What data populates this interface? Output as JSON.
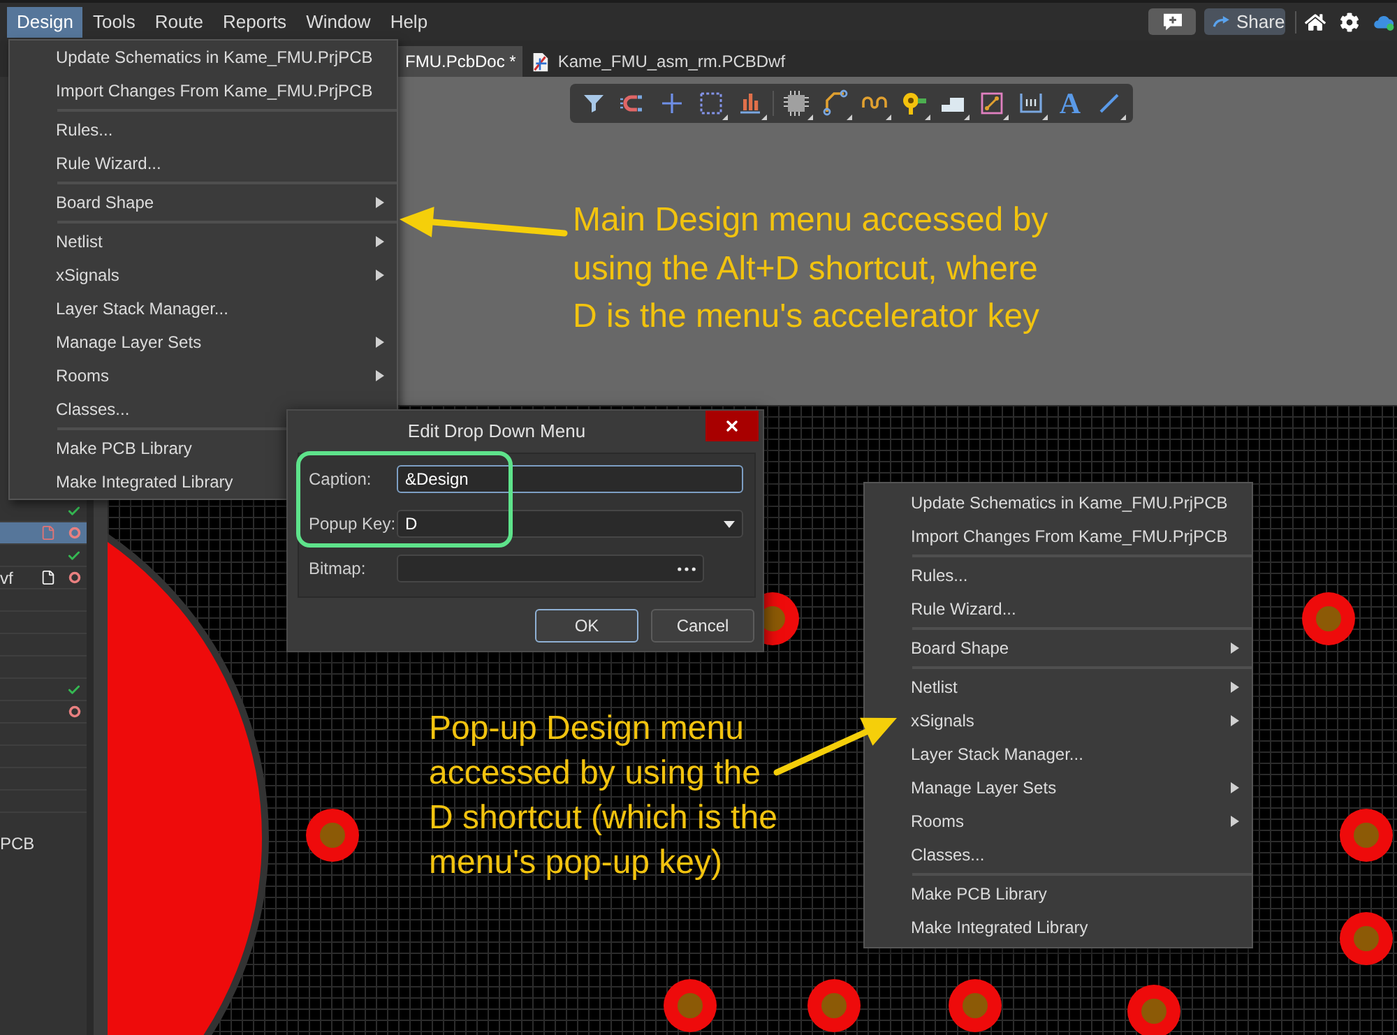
{
  "menu_bar": {
    "items": [
      {
        "label": "Design",
        "selected": true
      },
      {
        "label": "Tools",
        "selected": false
      },
      {
        "label": "Route",
        "selected": false
      },
      {
        "label": "Reports",
        "selected": false
      },
      {
        "label": "Window",
        "selected": false
      },
      {
        "label": "Help",
        "selected": false
      }
    ],
    "share_button": "Share"
  },
  "document_tabs": [
    {
      "label": "FMU.PcbDoc *",
      "selected": true
    },
    {
      "label": "Kame_FMU_asm_rm.PCBDwf",
      "selected": false,
      "kind": "drawing"
    }
  ],
  "design_menu": {
    "groups": [
      [
        {
          "label": "Update Schematics in Kame_FMU.PrjPCB",
          "submenu": false
        },
        {
          "label": "Import Changes From Kame_FMU.PrjPCB",
          "submenu": false
        }
      ],
      [
        {
          "label": "Rules...",
          "submenu": false
        },
        {
          "label": "Rule Wizard...",
          "submenu": false
        }
      ],
      [
        {
          "label": "Board Shape",
          "submenu": true
        }
      ],
      [
        {
          "label": "Netlist",
          "submenu": true
        },
        {
          "label": "xSignals",
          "submenu": true
        },
        {
          "label": "Layer Stack Manager...",
          "submenu": false
        },
        {
          "label": "Manage Layer Sets",
          "submenu": true
        },
        {
          "label": "Rooms",
          "submenu": true
        },
        {
          "label": "Classes...",
          "submenu": false
        }
      ],
      [
        {
          "label": "Make PCB Library",
          "submenu": false
        },
        {
          "label": "Make Integrated Library",
          "submenu": false
        }
      ]
    ]
  },
  "toolbar": {
    "text_tool_glyph": "A"
  },
  "left_panel": {
    "rows": [
      {
        "kind": "check",
        "selected": false
      },
      {
        "kind": "modified_document",
        "selected": true
      },
      {
        "kind": "check",
        "selected": false
      },
      {
        "kind": "document",
        "label": "vf",
        "selected": false
      },
      {
        "kind": "empty",
        "selected": false
      },
      {
        "kind": "empty",
        "selected": false
      },
      {
        "kind": "empty",
        "selected": false
      },
      {
        "kind": "empty",
        "selected": false
      },
      {
        "kind": "check",
        "selected": false
      },
      {
        "kind": "ring",
        "selected": false
      },
      {
        "kind": "empty",
        "selected": false
      },
      {
        "kind": "empty",
        "selected": false
      },
      {
        "kind": "empty",
        "selected": false
      },
      {
        "kind": "empty",
        "selected": false
      }
    ],
    "label": "PCB"
  },
  "dialog": {
    "title": "Edit Drop Down Menu",
    "fields": [
      {
        "kind": "text",
        "label": "Caption:",
        "value": "&Design",
        "focused": true
      },
      {
        "kind": "dropdown",
        "label": "Popup Key:",
        "value": "D",
        "focused": false
      },
      {
        "kind": "browse",
        "label": "Bitmap:",
        "focused": false
      }
    ],
    "buttons": [
      {
        "label": "OK",
        "default": true
      },
      {
        "label": "Cancel",
        "default": false
      }
    ]
  },
  "popup_menu": {
    "groups": [
      [
        {
          "label": "Update Schematics in Kame_FMU.PrjPCB",
          "submenu": false
        },
        {
          "label": "Import Changes From Kame_FMU.PrjPCB",
          "submenu": false
        }
      ],
      [
        {
          "label": "Rules...",
          "submenu": false
        },
        {
          "label": "Rule Wizard...",
          "submenu": false
        }
      ],
      [
        {
          "label": "Board Shape",
          "submenu": true
        }
      ],
      [
        {
          "label": "Netlist",
          "submenu": true
        },
        {
          "label": "xSignals",
          "submenu": true
        },
        {
          "label": "Layer Stack Manager...",
          "submenu": false
        },
        {
          "label": "Manage Layer Sets",
          "submenu": true
        },
        {
          "label": "Rooms",
          "submenu": true
        },
        {
          "label": "Classes...",
          "submenu": false
        }
      ],
      [
        {
          "label": "Make PCB Library",
          "submenu": false
        },
        {
          "label": "Make Integrated Library",
          "submenu": false
        }
      ]
    ]
  },
  "annotations": [
    {
      "lines": [
        "Main Design menu accessed by",
        "using the Alt+D shortcut, where",
        "D is the menu's accelerator key"
      ]
    },
    {
      "lines": [
        "Pop-up Design menu",
        "accessed by using the",
        "D shortcut (which is the",
        "menu's pop-up key)"
      ]
    }
  ]
}
